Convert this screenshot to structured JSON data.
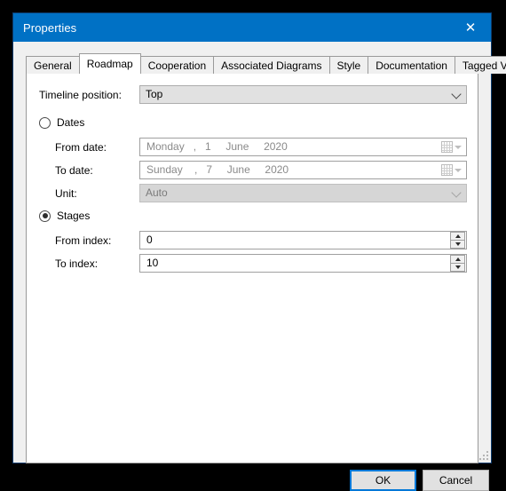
{
  "window": {
    "title": "Properties",
    "close_icon": "close-icon"
  },
  "tabs": [
    {
      "label": "General",
      "selected": false
    },
    {
      "label": "Roadmap",
      "selected": true
    },
    {
      "label": "Cooperation",
      "selected": false
    },
    {
      "label": "Associated Diagrams",
      "selected": false
    },
    {
      "label": "Style",
      "selected": false
    },
    {
      "label": "Documentation",
      "selected": false
    },
    {
      "label": "Tagged Values",
      "selected": false
    }
  ],
  "roadmap": {
    "timeline_position": {
      "label": "Timeline position:",
      "value": "Top",
      "enabled": true
    },
    "dates": {
      "radio_label": "Dates",
      "selected": false,
      "from_date": {
        "label": "From date:",
        "value": "Monday   ,   1     June     2020",
        "enabled": false
      },
      "to_date": {
        "label": "To date:",
        "value": "Sunday    ,   7     June     2020",
        "enabled": false
      },
      "unit": {
        "label": "Unit:",
        "value": "Auto",
        "enabled": false
      }
    },
    "stages": {
      "radio_label": "Stages",
      "selected": true,
      "from_index": {
        "label": "From index:",
        "value": "0",
        "enabled": true
      },
      "to_index": {
        "label": "To index:",
        "value": "10",
        "enabled": true
      }
    }
  },
  "footer": {
    "ok_label": "OK",
    "cancel_label": "Cancel"
  },
  "colors": {
    "titlebar": "#0071c5",
    "focus_border": "#0078d7",
    "dialog_face": "#f0f0f0",
    "panel": "#ffffff"
  }
}
